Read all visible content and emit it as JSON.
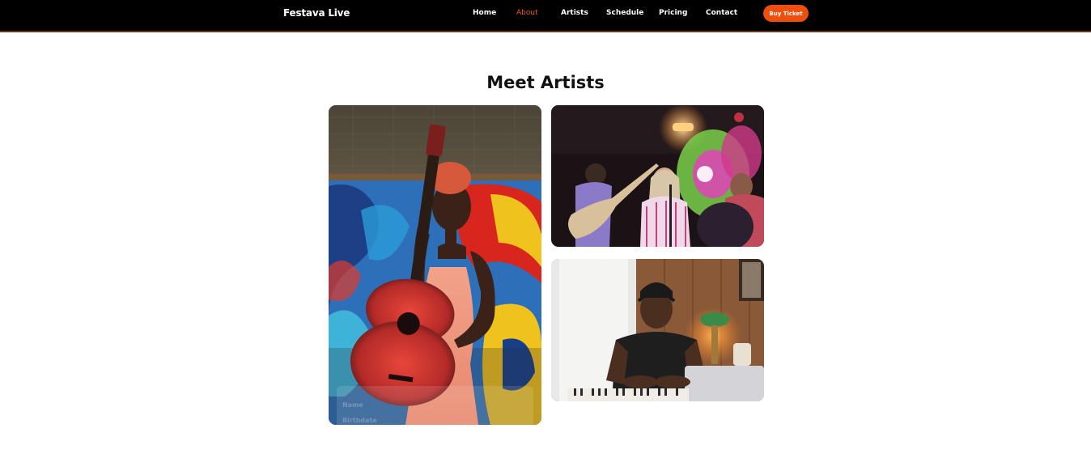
{
  "brand": "Festava Live",
  "nav": {
    "items": [
      {
        "label": "Home",
        "active": false
      },
      {
        "label": "About",
        "active": true
      },
      {
        "label": "Artists",
        "active": false
      },
      {
        "label": "Schedule",
        "active": false
      },
      {
        "label": "Pricing",
        "active": false
      },
      {
        "label": "Contact",
        "active": false
      }
    ],
    "ticket_button": "Buy Ticket"
  },
  "section": {
    "title": "Meet Artists"
  },
  "cards": {
    "overlay_line1": "Name",
    "overlay_line2": "Birthdate"
  },
  "colors": {
    "nav_bg": "#000000",
    "accent": "#f04e0c",
    "active_link": "#f05a14"
  }
}
